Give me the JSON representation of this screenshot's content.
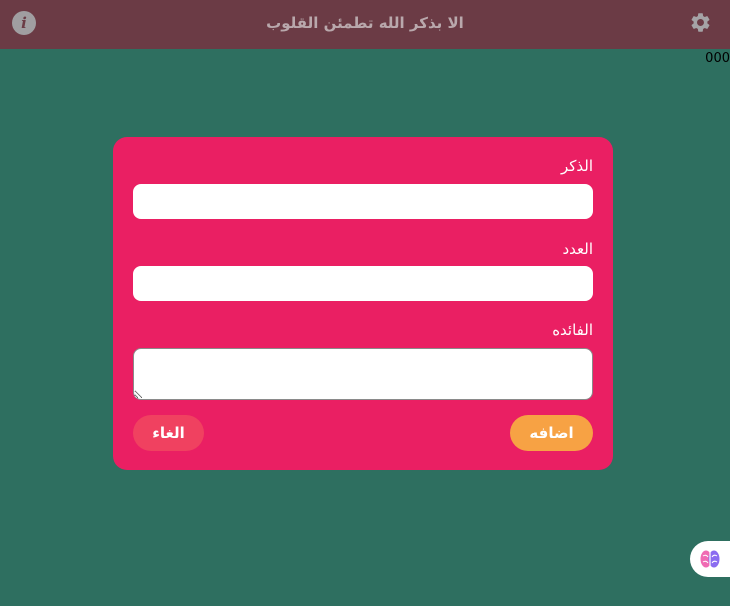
{
  "header": {
    "title": "الا بذكر الله تطمئن القلوب",
    "info_icon": "info-icon",
    "settings_icon": "gear-icon"
  },
  "counter": "000",
  "form": {
    "dhikr_label": "الذكر",
    "dhikr_value": "",
    "count_label": "العدد",
    "count_value": "",
    "benefit_label": "الفائده",
    "benefit_value": "",
    "add_button": "اضافه",
    "cancel_button": "الغاء"
  },
  "floating": {
    "icon": "brain-icon"
  },
  "colors": {
    "background": "#2e6f60",
    "header": "#6b3b45",
    "card": "#ea1f63",
    "add_button": "#f7a244",
    "cancel_button": "#f04160"
  }
}
